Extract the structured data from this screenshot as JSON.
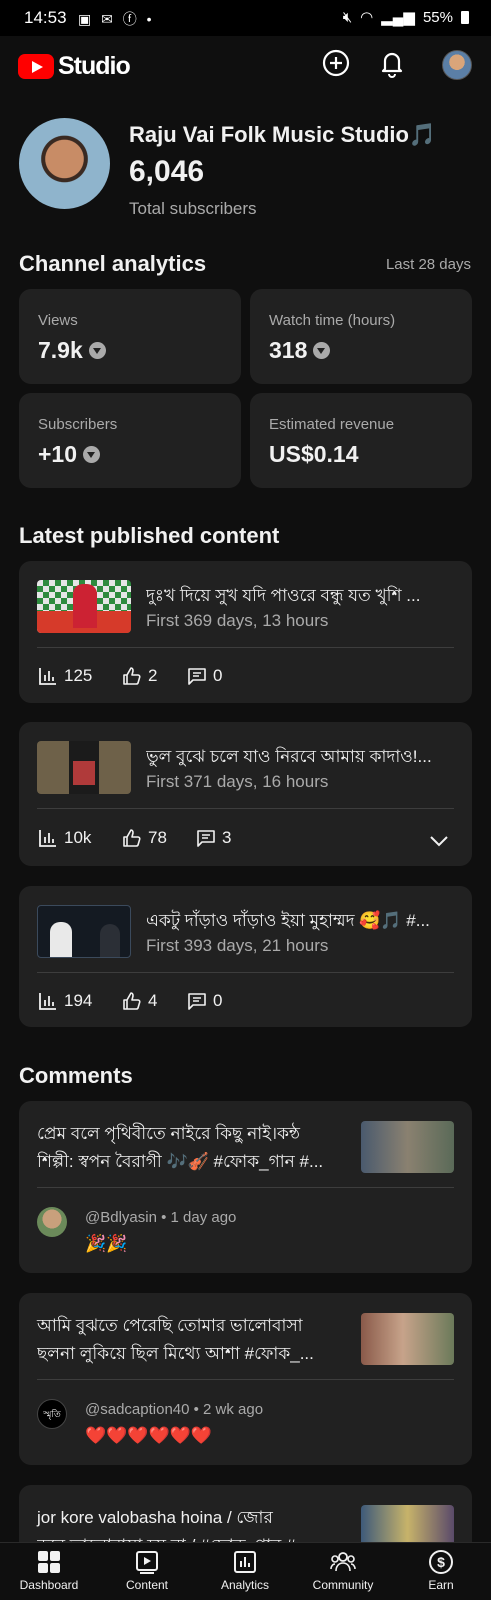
{
  "status_bar": {
    "time": "14:53",
    "battery": "55%"
  },
  "header": {
    "logo_text": "Studio",
    "icons": [
      "create-plus-icon",
      "notifications-bell-icon",
      "account-avatar"
    ]
  },
  "channel": {
    "name": "Raju Vai Folk Music Studio🎵",
    "subscribers": "6,046",
    "subscribers_label": "Total subscribers"
  },
  "analytics": {
    "title": "Channel analytics",
    "period": "Last 28 days",
    "cards": [
      {
        "label": "Views",
        "value": "7.9k",
        "trend": "down"
      },
      {
        "label": "Watch time (hours)",
        "value": "318",
        "trend": "down"
      },
      {
        "label": "Subscribers",
        "value": "+10",
        "trend": "down"
      },
      {
        "label": "Estimated revenue",
        "value": "US$0.14",
        "trend": "none"
      }
    ]
  },
  "latest": {
    "title": "Latest published content",
    "items": [
      {
        "title": "দুঃখ দিয়ে সুখ যদি পাওরে বন্ধু যত খুশি ...",
        "subtitle": "First 369 days, 13 hours",
        "views": "125",
        "likes": "2",
        "comments": "0"
      },
      {
        "title": "ভুল বুঝে চলে যাও নিরবে আমায় কাদাও!...",
        "subtitle": "First 371 days, 16 hours",
        "views": "10k",
        "likes": "78",
        "comments": "3"
      },
      {
        "title": "একটু দাঁড়াও দাঁড়াও ইয়া মুহাম্মদ 🥰🎵 #...",
        "subtitle": "First 393 days, 21 hours",
        "views": "194",
        "likes": "4",
        "comments": "0"
      }
    ]
  },
  "comments": {
    "title": "Comments",
    "items": [
      {
        "video_line1": "প্রেম বলে পৃথিবীতে নাইরে কিছু নাই।কন্ঠ",
        "video_line2": "শিল্পী: স্বপন বৈরাগী 🎶🎻 #ফোক_গান #...",
        "author": "@Bdlyasin • 1 day ago",
        "text": "🎉🎉"
      },
      {
        "video_line1": "আমি বুঝতে পেরেছি তোমার ভালোবাসা",
        "video_line2": "ছলনা লুকিয়ে ছিল মিথ্যে আশা #ফোক_...",
        "author": "@sadcaption40 • 2 wk ago",
        "text": "❤️❤️❤️❤️❤️❤️",
        "avatar_text": "স্মৃতি"
      },
      {
        "video_line1": "jor kore valobasha hoina / জোর",
        "video_line2": "করে ভালোবাসা হয় না / #ফোক_গান #..."
      }
    ]
  },
  "bottom_nav": [
    {
      "label": "Dashboard",
      "icon": "dashboard-icon"
    },
    {
      "label": "Content",
      "icon": "content-icon"
    },
    {
      "label": "Analytics",
      "icon": "analytics-icon"
    },
    {
      "label": "Community",
      "icon": "community-icon"
    },
    {
      "label": "Earn",
      "icon": "earn-icon"
    }
  ]
}
